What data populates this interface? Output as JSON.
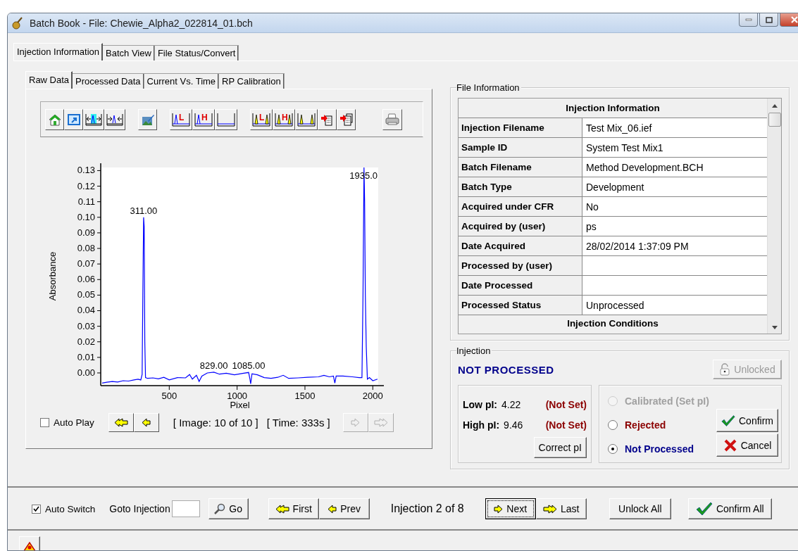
{
  "window": {
    "title": "Batch Book - File: Chewie_Alpha2_022814_01.bch"
  },
  "tabs": [
    {
      "label": "Injection Information",
      "selected": true
    },
    {
      "label": "Batch View",
      "selected": false
    },
    {
      "label": "File Status/Convert",
      "selected": false
    }
  ],
  "data_tabs": [
    {
      "label": "Raw Data",
      "selected": true
    },
    {
      "label": "Processed Data",
      "selected": false
    },
    {
      "label": "Current Vs. Time",
      "selected": false
    },
    {
      "label": "RP Calibration",
      "selected": false
    }
  ],
  "toolbar": [
    [
      {
        "kind": "home"
      },
      {
        "kind": "popout"
      },
      {
        "kind": "zoom-peaks"
      },
      {
        "kind": "fit-peaks"
      }
    ],
    [
      {
        "kind": "edit-image"
      }
    ],
    [
      {
        "kind": "marker",
        "label": "L"
      },
      {
        "kind": "marker",
        "label": "H"
      },
      {
        "kind": "baseline"
      }
    ],
    [
      {
        "kind": "peak-marker",
        "label": "L"
      },
      {
        "kind": "peak-marker",
        "label": "H"
      },
      {
        "kind": "peak-baseline"
      },
      {
        "kind": "export"
      },
      {
        "kind": "export-all"
      }
    ],
    [
      {
        "kind": "print"
      }
    ]
  ],
  "chart": {
    "chart_data": {
      "type": "line",
      "xlabel": "Pixel",
      "ylabel": "Absorbance",
      "xlim": [
        0,
        2040
      ],
      "ylim": [
        -0.0077,
        0.132
      ],
      "xticks": [
        500,
        1000,
        1500,
        2000
      ],
      "yticks": [
        {
          "value": 0,
          "label": "0.00"
        },
        {
          "value": 0.01,
          "label": "0.01"
        },
        {
          "value": 0.02,
          "label": "0.02"
        },
        {
          "value": 0.03,
          "label": "0.03"
        },
        {
          "value": 0.04,
          "label": "0.04"
        },
        {
          "value": 0.05,
          "label": "0.05"
        },
        {
          "value": 0.06,
          "label": "0.06"
        },
        {
          "value": 0.07,
          "label": "0.07"
        },
        {
          "value": 0.08,
          "label": "0.08"
        },
        {
          "value": 0.09,
          "label": "0.09"
        },
        {
          "value": 0.1,
          "label": "0.10"
        },
        {
          "value": 0.11,
          "label": "0.11"
        },
        {
          "value": 0.12,
          "label": "0.12"
        },
        {
          "value": 0.13,
          "label": "0.13"
        }
      ],
      "x": [
        5,
        40,
        80,
        120,
        160,
        200,
        240,
        270,
        290,
        300,
        305,
        311,
        315,
        320,
        325,
        340,
        380,
        420,
        460,
        500,
        560,
        620,
        650,
        670,
        700,
        720,
        740,
        780,
        829,
        870,
        920,
        980,
        1040,
        1085,
        1095,
        1100,
        1110,
        1150,
        1200,
        1250,
        1300,
        1340,
        1380,
        1450,
        1520,
        1600,
        1640,
        1680,
        1710,
        1720,
        1730,
        1780,
        1850,
        1900,
        1920,
        1928,
        1935,
        1940,
        1945,
        1952,
        1960,
        1975,
        2000,
        2035
      ],
      "series": [
        {
          "color": "#0000ff",
          "values": [
            -0.0065,
            -0.006,
            -0.0055,
            -0.0058,
            -0.005,
            -0.0052,
            -0.0045,
            -0.004,
            -0.0045,
            -0.001,
            0.05,
            0.1,
            0.094,
            0.02,
            -0.003,
            -0.0035,
            -0.0032,
            -0.0038,
            -0.0028,
            -0.0045,
            -0.003,
            -0.0032,
            -0.001,
            -0.004,
            -0.0015,
            -0.0055,
            -0.002,
            0.0,
            0.0005,
            -0.0008,
            -0.0002,
            -0.0012,
            -0.0003,
            0.0003,
            -0.004,
            -0.007,
            -0.0005,
            -0.0012,
            -0.003,
            -0.0035,
            -0.0028,
            -0.0015,
            -0.0035,
            -0.0032,
            -0.0028,
            -0.0025,
            -0.0015,
            -0.0025,
            -0.002,
            -0.0065,
            -0.002,
            -0.002,
            -0.0025,
            -0.003,
            -0.003,
            0.05,
            0.132,
            0.11,
            0.05,
            0.017,
            -0.004,
            -0.003,
            -0.005,
            -0.004
          ]
        }
      ],
      "annotations": [
        {
          "x": 311,
          "y": 0.1,
          "text": "311.00"
        },
        {
          "x": 829,
          "y": 0.0005,
          "text": "829.00"
        },
        {
          "x": 1085,
          "y": 0.0003,
          "text": "1085.00"
        },
        {
          "x": 1935,
          "y": 0.132,
          "text": "1935.0"
        }
      ]
    }
  },
  "playback": {
    "auto_play": {
      "label": "Auto Play",
      "checked": false
    },
    "buttons": [
      {
        "kind": "first",
        "disabled": false
      },
      {
        "kind": "prev",
        "disabled": false
      }
    ],
    "image": "[ Image: 10 of 10 ]",
    "time": "[ Time: 333s ]",
    "buttons_after": [
      {
        "kind": "next",
        "disabled": true
      },
      {
        "kind": "last",
        "disabled": true
      }
    ]
  },
  "file_information": {
    "title": "File Information",
    "header": "Injection Information",
    "rows": [
      {
        "label": "Injection Filename",
        "value": "Test Mix_06.ief"
      },
      {
        "label": "Sample ID",
        "value": "System Test Mix1"
      },
      {
        "label": "Batch Filename",
        "value": "Method Development.BCH"
      },
      {
        "label": "Batch Type",
        "value": "Development"
      },
      {
        "label": "Acquired under CFR",
        "value": "No"
      },
      {
        "label": "Acquired by (user)",
        "value": "ps"
      },
      {
        "label": "Date Acquired",
        "value": "28/02/2014 1:37:09 PM"
      },
      {
        "label": "Processed by (user)"
      },
      {
        "label": "Date Processed"
      },
      {
        "label": "Processed Status",
        "value": "Unprocessed"
      }
    ],
    "next_header": "Injection Conditions"
  },
  "injection": {
    "title": "Injection",
    "status": "NOT PROCESSED",
    "unlock_button": {
      "label": "Unlocked",
      "disabled": true
    },
    "pi": [
      {
        "label": "Low pI:",
        "value": "4.22",
        "state": "(Not Set)"
      },
      {
        "label": "High pI:",
        "value": "9.46",
        "state": "(Not Set)"
      }
    ],
    "correct_button": "Correct pI",
    "options": [
      {
        "label": "Calibrated (Set pI)",
        "selected": false,
        "disabled": true,
        "color": "#a0a0a0"
      },
      {
        "label": "Rejected",
        "selected": false,
        "disabled": false,
        "color": "#8b0000"
      },
      {
        "label": "Not Processed",
        "selected": true,
        "disabled": false,
        "color": "#00008b"
      }
    ],
    "confirm_button": "Confirm",
    "cancel_button": "Cancel"
  },
  "bottom_bar": {
    "auto_switch": {
      "label": "Auto Switch",
      "checked": true
    },
    "goto_label": "Goto Injection",
    "go_button": "Go",
    "nav_left": [
      {
        "kind": "first",
        "label": "First",
        "focused": false
      },
      {
        "kind": "prev",
        "label": "Prev",
        "focused": false
      }
    ],
    "position": "Injection 2 of 8",
    "nav_right": [
      {
        "kind": "next",
        "label": "Next",
        "focused": true
      },
      {
        "kind": "last",
        "label": "Last",
        "focused": false
      }
    ],
    "unlock_all": "Unlock All",
    "confirm_all": "Confirm All"
  }
}
